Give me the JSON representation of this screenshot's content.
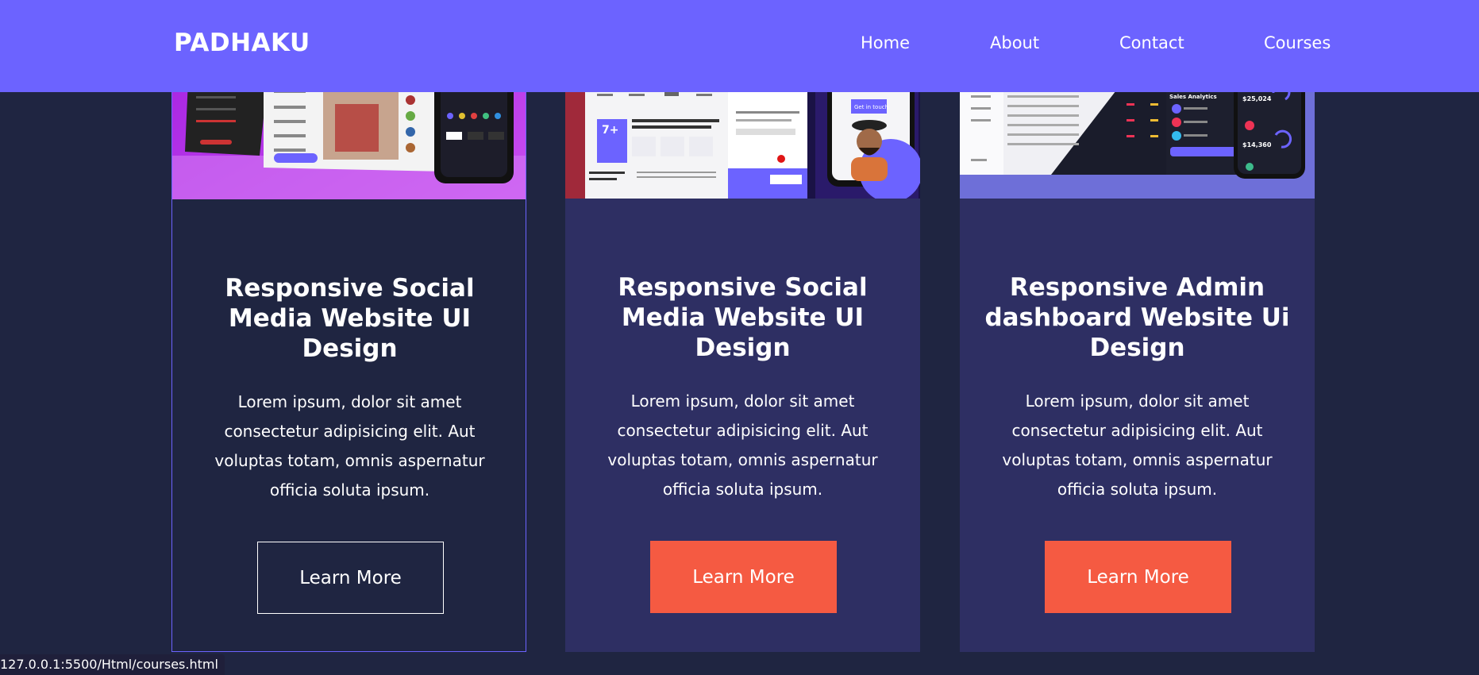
{
  "header": {
    "logo": "PADHAKU",
    "nav": [
      {
        "label": "Home"
      },
      {
        "label": "About"
      },
      {
        "label": "Contact"
      },
      {
        "label": "Courses"
      }
    ]
  },
  "cards": [
    {
      "title": "Responsive Social Media Website UI Design",
      "text": "Lorem ipsum, dolor sit amet consectetur adipisicing elit. Aut voluptas totam, omnis aspernatur officia soluta ipsum.",
      "button": "Learn More"
    },
    {
      "title": "Responsive Social Media Website UI Design",
      "text": "Lorem ipsum, dolor sit amet consectetur adipisicing elit. Aut voluptas totam, omnis aspernatur officia soluta ipsum.",
      "button": "Learn More"
    },
    {
      "title": "Responsive Admin dashboard Website Ui Design",
      "text": "Lorem ipsum, dolor sit amet consectetur adipisicing elit. Aut voluptas totam, omnis aspernatur officia soluta ipsum.",
      "button": "Learn More"
    }
  ],
  "card2_image": {
    "badge": "7+",
    "cta": "Get in touch"
  },
  "card3_image": {
    "panel_title": "Sales Analytics",
    "stat_1": "$25,024",
    "stat_2": "$14,360"
  },
  "status_bar": {
    "url": "127.0.0.1:5500/Html/courses.html"
  },
  "colors": {
    "page_bg": "#1f2541",
    "navbar": "#6c63ff",
    "card_bg": "#2e2f63",
    "button": "#f55a42"
  }
}
